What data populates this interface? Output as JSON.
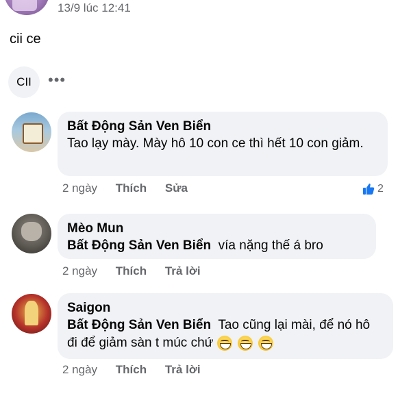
{
  "post": {
    "timestamp": "13/9 lúc 12:41",
    "text": "cii ce"
  },
  "reaction_chip": {
    "label": "CII",
    "more_label": "•••"
  },
  "comments": [
    {
      "author": "Bất Động Sản Ven Biển",
      "text": "Tao lạy mày. Mày hô 10 con ce thì hết 10 con giảm.",
      "time": "2 ngày",
      "actions": [
        "Thích",
        "Sửa"
      ],
      "like_count": "2"
    },
    {
      "author": "Mèo Mun",
      "mention": "Bất Động Sản Ven Biển",
      "text": "vía nặng thế á bro",
      "time": "2 ngày",
      "actions": [
        "Thích",
        "Trả lời"
      ]
    },
    {
      "author": "Saigon",
      "mention": "Bất Động Sản Ven Biển",
      "text": "Tao cũng lại mài, để nó hô đi để giảm sàn t múc chứ",
      "emoji": [
        "grinning-face",
        "grinning-face",
        "grinning-face"
      ],
      "time": "2 ngày",
      "actions": [
        "Thích",
        "Trả lời"
      ]
    }
  ],
  "colors": {
    "bubble": "#f0f2f5",
    "secondary_text": "#65676b",
    "like_blue": "#1877f2"
  }
}
